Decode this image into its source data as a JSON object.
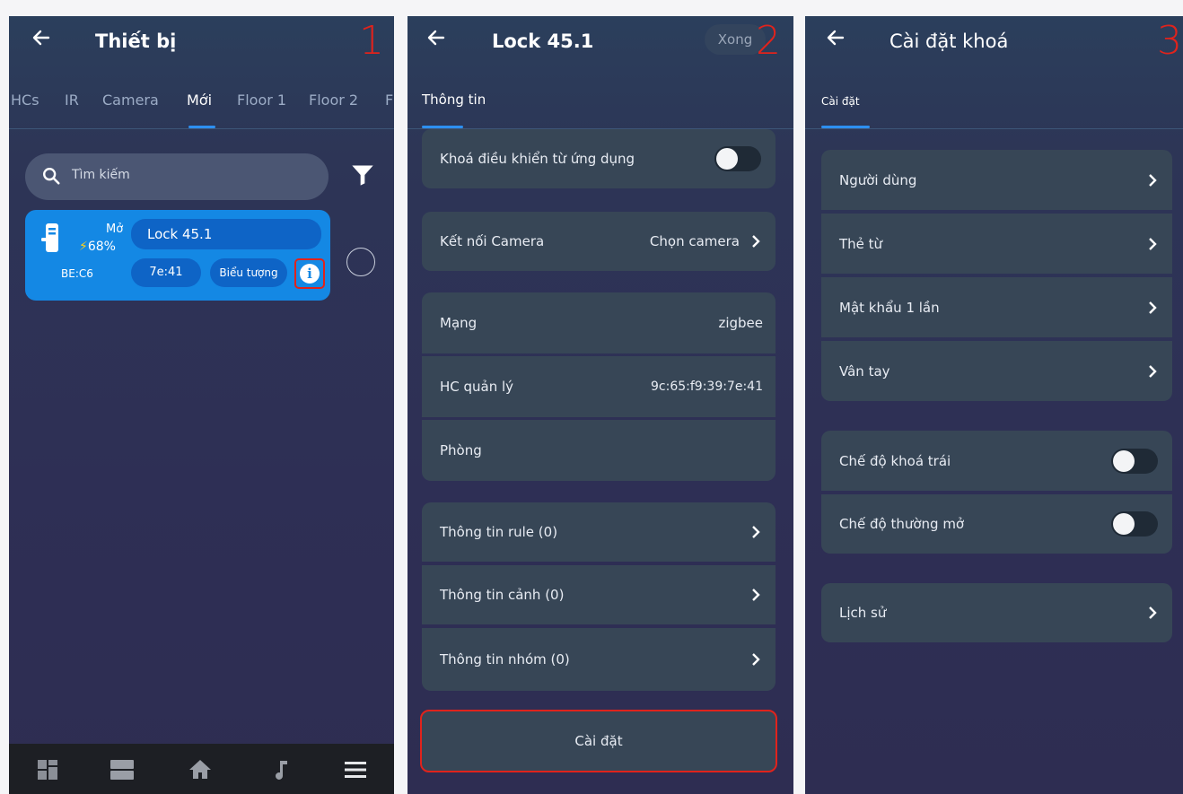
{
  "colors": {
    "accent": "#2d8ff0",
    "card": "#1488e4",
    "annotation": "#e0231c",
    "row_bg": "#374656"
  },
  "screen1": {
    "step": "1",
    "title": "Thiết bị",
    "tabs": [
      "HCs",
      "IR",
      "Camera",
      "Mới",
      "Floor 1",
      "Floor 2",
      "F"
    ],
    "active_tab": "Mới",
    "search_placeholder": "Tìm kiếm",
    "device": {
      "state": "Mở",
      "battery": "68%",
      "mac": "BE:C6",
      "name": "Lock 45.1",
      "short_id": "7e:41",
      "icon_label": "Biểu tượng",
      "info_icon": "info-icon"
    },
    "bottom_nav": [
      "dashboard-icon",
      "list-icon",
      "home-icon",
      "music-icon",
      "menu-icon"
    ]
  },
  "screen2": {
    "step": "2",
    "title": "Lock 45.1",
    "done_label": "Xong",
    "tab": "Thông tin",
    "app_lock_label": "Khoá điều khiển từ ứng dụng",
    "camera_label": "Kết nối Camera",
    "camera_value": "Chọn camera",
    "network_label": "Mạng",
    "network_value": "zigbee",
    "hc_label": "HC quản lý",
    "hc_value": "9c:65:f9:39:7e:41",
    "room_label": "Phòng",
    "rule_label": "Thông tin rule (0)",
    "scene_label": "Thông tin cảnh (0)",
    "group_label": "Thông tin nhóm (0)",
    "settings_button": "Cài đặt"
  },
  "screen3": {
    "step": "3",
    "title": "Cài đặt khoá",
    "tab": "Cài đặt",
    "users_label": "Người dùng",
    "card_label": "Thẻ từ",
    "otp_label": "Mật khẩu 1 lần",
    "fingerprint_label": "Vân tay",
    "lock_mode_label": "Chế độ khoá trái",
    "open_mode_label": "Chế độ thường mở",
    "history_label": "Lịch sử"
  }
}
